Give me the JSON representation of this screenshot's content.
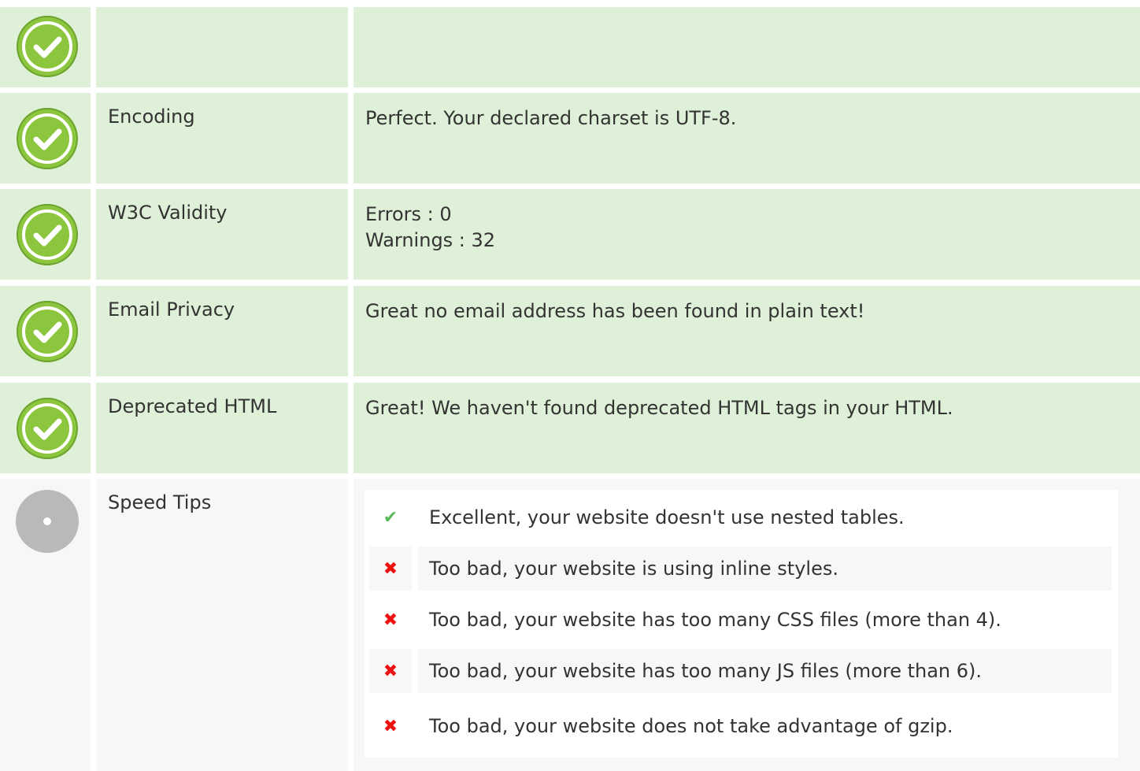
{
  "colors": {
    "pass_background": "#dff0d8",
    "info_background": "#f7f7f7",
    "pass_icon": "#8cc63f",
    "fail_icon": "#ee1111"
  },
  "rows": [
    {
      "status": "pass",
      "icon": "check-circle-icon",
      "label": "",
      "values": [
        ""
      ]
    },
    {
      "status": "pass",
      "icon": "check-circle-icon",
      "label": "Encoding",
      "values": [
        "Perfect. Your declared charset is UTF-8."
      ]
    },
    {
      "status": "pass",
      "icon": "check-circle-icon",
      "label": "W3C Validity",
      "values": [
        "Errors : 0",
        "Warnings : 32"
      ]
    },
    {
      "status": "pass",
      "icon": "check-circle-icon",
      "label": "Email Privacy",
      "values": [
        "Great no email address has been found in plain text!"
      ]
    },
    {
      "status": "pass",
      "icon": "check-circle-icon",
      "label": "Deprecated HTML",
      "values": [
        "Great! We haven't found deprecated HTML tags in your HTML."
      ]
    }
  ],
  "speed_tips": {
    "label": "Speed Tips",
    "icon": "neutral-circle-icon",
    "items": [
      {
        "status": "pass",
        "icon": "checkmark-icon",
        "text": "Excellent, your website doesn't use nested tables."
      },
      {
        "status": "fail",
        "icon": "cross-icon",
        "text": "Too bad, your website is using inline styles."
      },
      {
        "status": "fail",
        "icon": "cross-icon",
        "text": "Too bad, your website has too many CSS files (more than 4)."
      },
      {
        "status": "fail",
        "icon": "cross-icon",
        "text": "Too bad, your website has too many JS files (more than 6)."
      },
      {
        "status": "fail",
        "icon": "cross-icon",
        "text": "Too bad, your website does not take advantage of gzip."
      }
    ]
  }
}
